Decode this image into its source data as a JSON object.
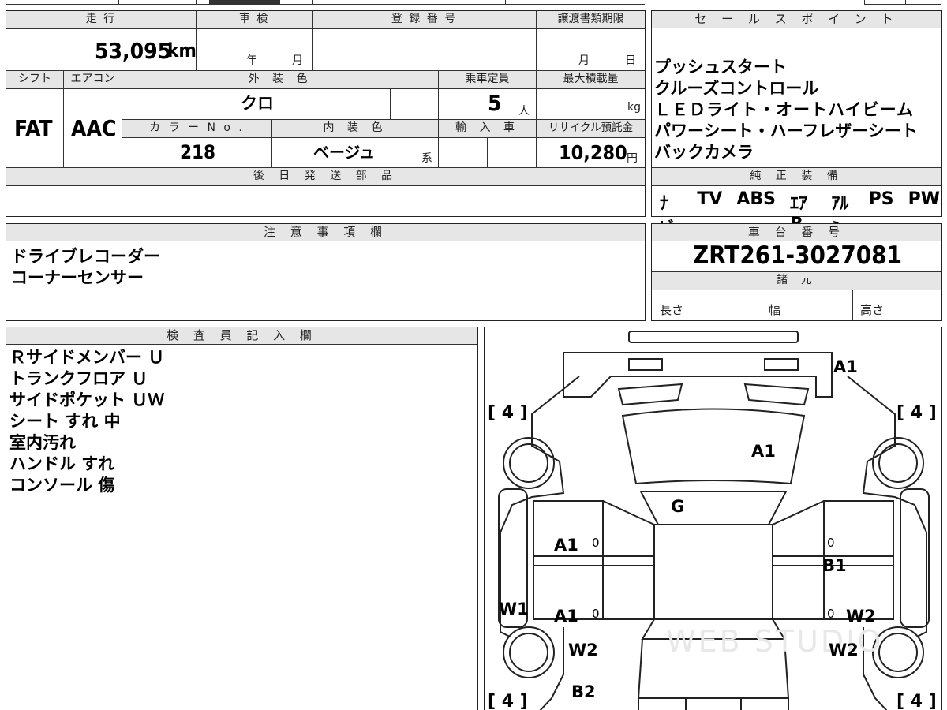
{
  "top": {
    "mileage_label": "走 行",
    "mileage_value": "53,095",
    "mileage_unit": "km",
    "shaken_label": "車 検",
    "shaken_year": "年",
    "shaken_month": "月",
    "reg_label": "登 録 番 号",
    "transfer_label": "譲渡書類期限",
    "transfer_month": "月",
    "transfer_day": "日"
  },
  "row2": {
    "shift_label": "シフト",
    "shift_value": "FAT",
    "ac_label": "エアコン",
    "ac_value": "AAC",
    "exterior_label": "外 装 色",
    "exterior_value": "クロ",
    "capacity_label": "乗車定員",
    "capacity_value": "5",
    "capacity_unit": "人",
    "load_label": "最大積載量",
    "load_unit": "kg",
    "color_no_label": "カ ラ ー N o .",
    "color_no_value": "218",
    "interior_label": "内 装 色",
    "interior_value": "ベージュ",
    "interior_suffix": "系",
    "import_label": "輸 入 車",
    "recycle_label": "リサイクル預託金",
    "recycle_value": "10,280",
    "recycle_unit": "円"
  },
  "later_parts_label": "後 日 発 送 部 品",
  "sales": {
    "label": "セ ー ル ス ポ イ ン ト",
    "items": [
      "プッシュスタート",
      "クルーズコントロール",
      "ＬＥＤライト・オートハイビーム",
      "パワーシート・ハーフレザーシート",
      "バックカメラ"
    ]
  },
  "genuine": {
    "label": "純 正 装 備",
    "items": [
      "ﾅﾋﾞ",
      "TV",
      "ABS",
      "ｴｱB",
      "ｱﾙﾐ",
      "PS",
      "PW"
    ]
  },
  "notes": {
    "label": "注 意 事 項 欄",
    "items": [
      "ドライブレコーダー",
      "コーナーセンサー"
    ]
  },
  "chassis": {
    "label": "車 台 番 号",
    "value": "ZRT261-3027081",
    "spec_label": "諸 元",
    "length_label": "長さ",
    "width_label": "幅",
    "height_label": "高さ"
  },
  "inspector": {
    "label": "検 査 員 記 入 欄",
    "items": [
      "Ｒサイドメンバー Ｕ",
      "トランクフロア Ｕ",
      "サイドポケット ＵＷ",
      "シート すれ 中",
      "室内汚れ",
      "ハンドル すれ",
      "コンソール 傷"
    ]
  },
  "diagram": {
    "marks": {
      "trunk": "A1",
      "rear_glass": "A1",
      "roof": "G",
      "left_rear_door": "A1",
      "left_front_door": "A1",
      "right_rear_door": "B1",
      "right_front_door": "W2",
      "left_rocker": "W1",
      "left_front_fender": "W2",
      "right_front_fender": "W2",
      "front_left": "B2"
    },
    "zero": "0",
    "tires": [
      "4",
      "4",
      "4",
      "4"
    ],
    "watermark": "WEB STUDIO"
  }
}
